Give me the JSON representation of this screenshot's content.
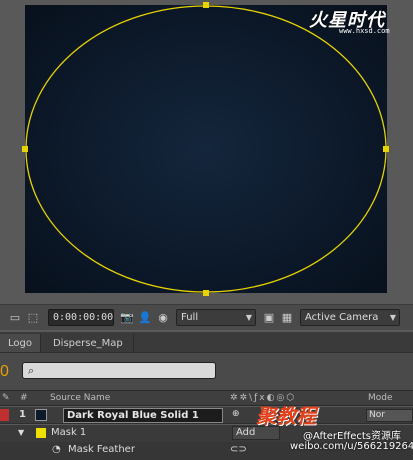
{
  "watermark": {
    "logo": "火星时代",
    "url": "www.hxsd.com"
  },
  "viewer_bar": {
    "timecode": "0:00:00:00",
    "resolution": "Full",
    "camera": "Active Camera"
  },
  "tabs": [
    {
      "label": "Logo"
    },
    {
      "label": "Disperse_Map"
    }
  ],
  "timeline": {
    "time_partial": "0",
    "search_placeholder": ""
  },
  "columns": {
    "num": "#",
    "source_name": "Source Name",
    "mode": "Mode"
  },
  "layers": [
    {
      "number": "1",
      "name": "Dark Royal Blue Solid 1",
      "mode": "Nor",
      "label_color": "#c03030"
    }
  ],
  "mask": {
    "name": "Mask 1",
    "mode": "Add",
    "property": "Mask Feather",
    "swatch_color": "#f0e000"
  },
  "bottom_watermark": {
    "line1": "聚教程",
    "line2": "@AfterEffects资源库",
    "line3": "weibo.com/u/5662192643"
  },
  "colors": {
    "mask_path": "#e8d400",
    "comp_background": "#0d1a2b",
    "timecode_accent": "#e8a000"
  }
}
